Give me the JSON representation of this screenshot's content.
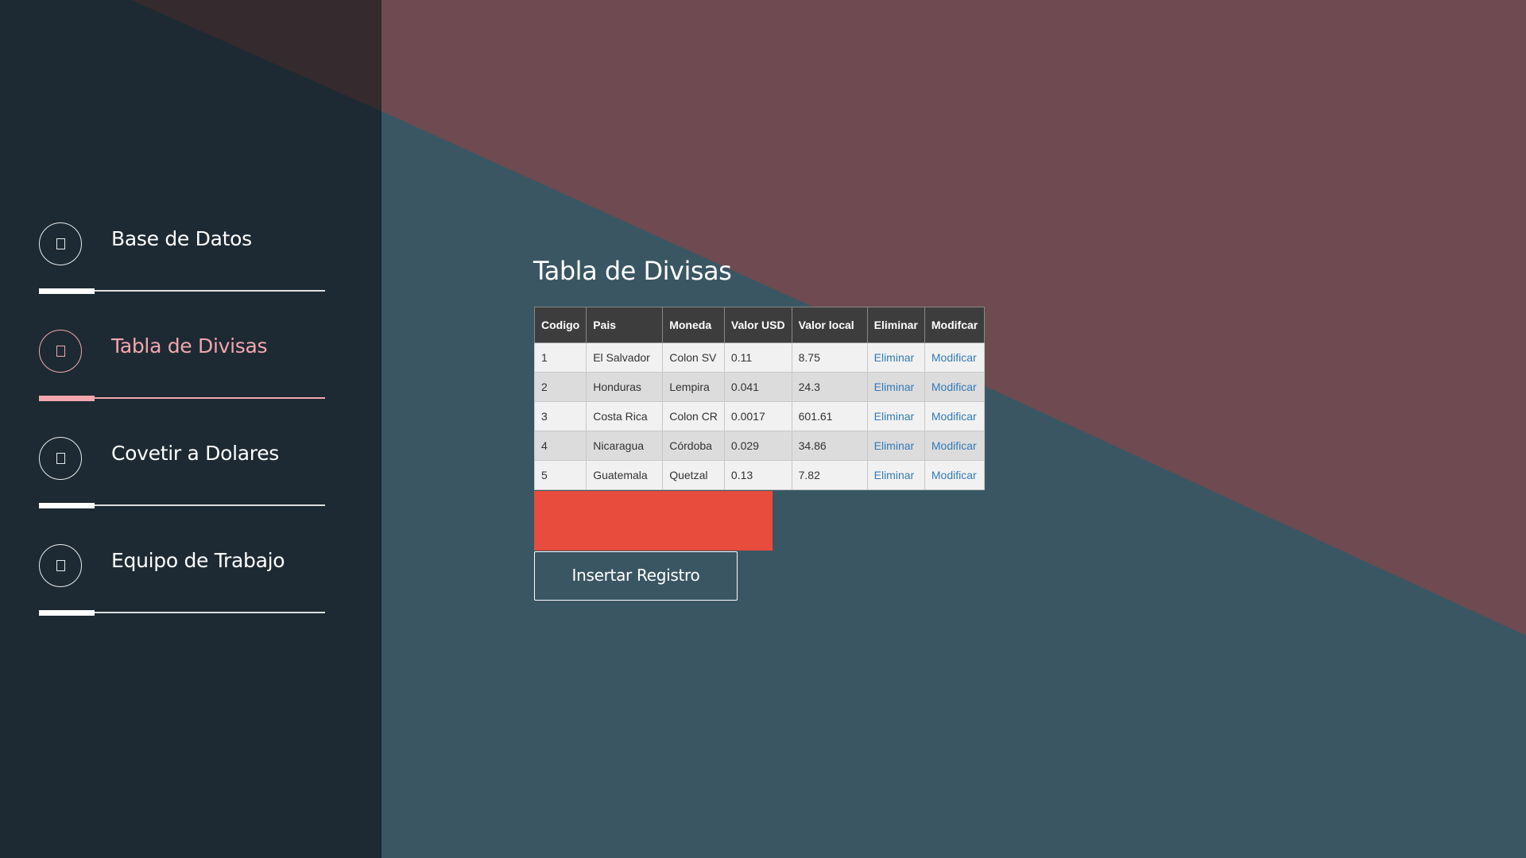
{
  "colors": {
    "sidebar_bg": "#1d2a33",
    "main_blue": "#3a5663",
    "main_red": "#6f4a51",
    "active_accent": "#f3a6ae",
    "table_header_bg": "#3d3d3d",
    "link_blue": "#337ab7",
    "red_block": "#e74c3c"
  },
  "sidebar": {
    "items": [
      {
        "label": "Base de Datos",
        "icon": "page-icon",
        "active": false
      },
      {
        "label": "Tabla de Divisas",
        "icon": "page-icon",
        "active": true
      },
      {
        "label": "Covetir a Dolares",
        "icon": "page-icon",
        "active": false
      },
      {
        "label": "Equipo de Trabajo",
        "icon": "page-icon",
        "active": false
      }
    ]
  },
  "main": {
    "title": "Tabla de Divisas",
    "table": {
      "headers": [
        "Codigo",
        "Pais",
        "Moneda",
        "Valor USD",
        "Valor local",
        "Eliminar",
        "Modifcar"
      ],
      "rows": [
        [
          "1",
          "El Salvador",
          "Colon SV",
          "0.11",
          "8.75",
          "Eliminar",
          "Modificar"
        ],
        [
          "2",
          "Honduras",
          "Lempira",
          "0.041",
          "24.3",
          "Eliminar",
          "Modificar"
        ],
        [
          "3",
          "Costa Rica",
          "Colon CR",
          "0.0017",
          "601.61",
          "Eliminar",
          "Modificar"
        ],
        [
          "4",
          "Nicaragua",
          "Córdoba",
          "0.029",
          "34.86",
          "Eliminar",
          "Modificar"
        ],
        [
          "5",
          "Guatemala",
          "Quetzal",
          "0.13",
          "7.82",
          "Eliminar",
          "Modificar"
        ]
      ]
    },
    "insert_button": "Insertar Registro"
  }
}
